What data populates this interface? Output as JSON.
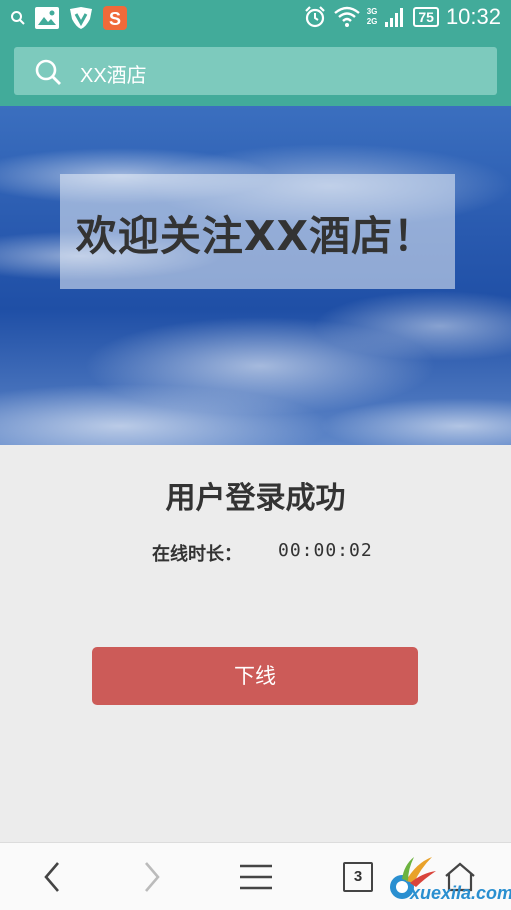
{
  "status_bar": {
    "time": "10:32",
    "battery": "75",
    "network_top": "3G",
    "network_bottom": "2G"
  },
  "search": {
    "text": "XX酒店"
  },
  "banner": {
    "title": "欢迎关注XX酒店！"
  },
  "main": {
    "title": "用户登录成功",
    "online_label": "在线时长：",
    "online_value": "00:00:02",
    "logout_label": "下线"
  },
  "bottom_bar": {
    "tab_count": "3"
  },
  "watermark": {
    "text": "xuexila.com"
  },
  "colors": {
    "accent": "#42ab9a",
    "button": "#cc5b58",
    "background": "#ececec"
  }
}
